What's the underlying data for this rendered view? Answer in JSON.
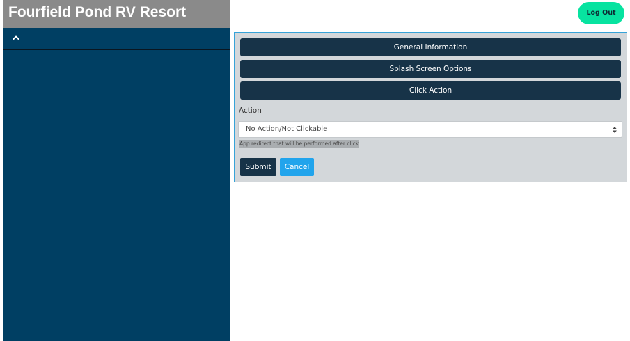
{
  "header": {
    "title": "Fourfield Pond RV Resort",
    "logout_label": "Log Out"
  },
  "sidebar": {
    "toggle_icon": "chevron-up-icon"
  },
  "panel": {
    "sections": [
      {
        "label": "General Information"
      },
      {
        "label": "Splash Screen Options"
      },
      {
        "label": "Click Action"
      }
    ],
    "action_label": "Action",
    "action_value": "No Action/Not Clickable",
    "action_help": "App redirect that will be performed after click",
    "submit_label": "Submit",
    "cancel_label": "Cancel"
  },
  "colors": {
    "header_bg": "#8a8a8a",
    "sidebar_bg": "#003f63",
    "logout_bg": "#07e3a0",
    "section_bg": "#173348",
    "panel_bg": "#d3d7da",
    "panel_border": "#36a3d8",
    "cancel_bg": "#21a4ec"
  }
}
